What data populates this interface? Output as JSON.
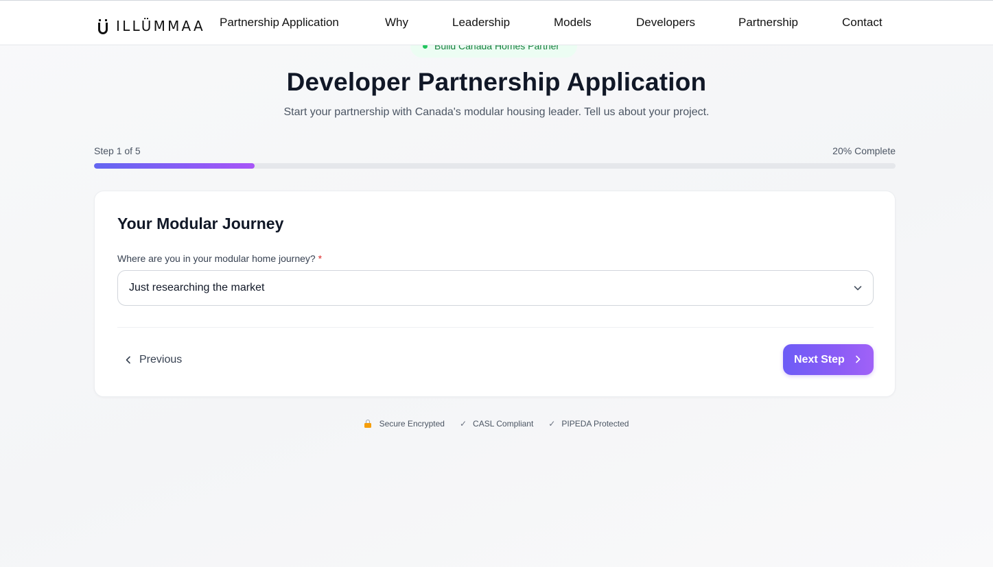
{
  "header": {
    "logo_text": "ILLÜMMAA",
    "nav": [
      {
        "label": "Partnership Application"
      },
      {
        "label": "Why"
      },
      {
        "label": "Leadership"
      },
      {
        "label": "Models"
      },
      {
        "label": "Developers"
      },
      {
        "label": "Partnership"
      },
      {
        "label": "Contact"
      }
    ]
  },
  "badge": {
    "label": "Build Canada Homes Partner",
    "dot_color": "#22c55e"
  },
  "hero": {
    "title": "Developer Partnership Application",
    "subtitle": "Start your partnership with Canada's modular housing leader. Tell us about your project."
  },
  "progress": {
    "step_label": "Step 1 of 5",
    "percent_label": "20% Complete",
    "fraction": 0.2
  },
  "form": {
    "section_title": "Your Modular Journey",
    "journey_label": "Where are you in your modular home journey?",
    "required_mark": "*",
    "journey_value": "Just researching the market",
    "previous_label": "Previous",
    "next_label": "Next Step"
  },
  "trust": {
    "secure": "Secure Encrypted",
    "casl": "CASL Compliant",
    "pipeda": "PIPEDA Protected",
    "check_glyph": "✓"
  },
  "colors": {
    "accent": "#8b5cf6",
    "accent_start": "#6366f1",
    "required": "#dc2626"
  },
  "icons": {
    "logo": "illummaa-u-logo-icon",
    "select": "chevron-down-icon",
    "previous": "chevron-left-icon",
    "next": "chevron-right-icon",
    "secure": "lock-icon",
    "check": "check-icon"
  }
}
